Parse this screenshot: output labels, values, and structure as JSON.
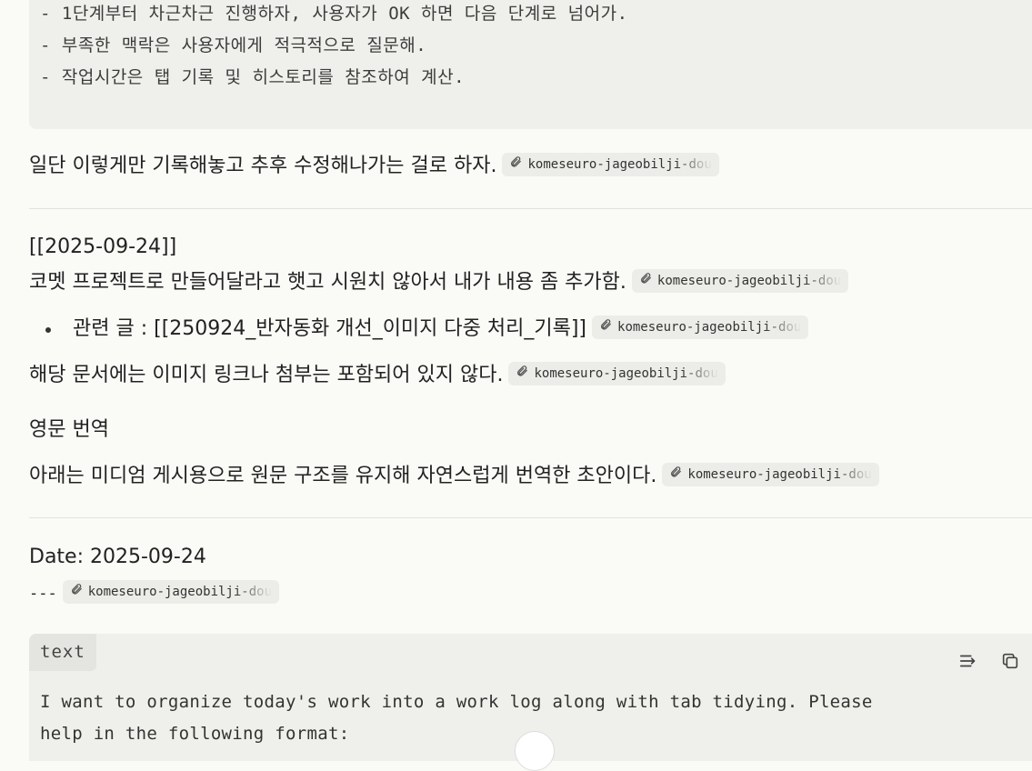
{
  "top_code": {
    "lines": [
      "- 1단계부터 차근차근 진행하자, 사용자가 OK 하면 다음 단계로 넘어가.",
      "- 부족한 맥락은 사용자에게 적극적으로 질문해.",
      "- 작업시간은 탭 기록 및 히스토리를 참조하여 계산."
    ]
  },
  "chip_label": "komeseuro-jageobilji-dou",
  "section1": {
    "note": "일단 이렇게만 기록해놓고 추후 수정해나가는 걸로 하자."
  },
  "section2": {
    "date_link": "[[2025-09-24]]",
    "line1": "코멧 프로젝트로 만들어달라고 햇고 시원치 않아서 내가 내용 좀 추가함.",
    "bullet": "관련 글 : [[250924_반자동화 개선_이미지 다중 처리_기록]]",
    "line2": "해당 문서에는 이미지 링크나 첨부는 포함되어 있지 않다.",
    "heading": "영문 번역",
    "line3": "아래는 미디엄 게시용으로 원문 구조를 유지해 자연스럽게 번역한 초안이다."
  },
  "section3": {
    "date_line": "Date: 2025-09-24",
    "separator": "---"
  },
  "code_block": {
    "lang": "text",
    "lines": [
      "I want to organize today's work into a work log along with tab tidying. Please",
      "help in the following format:"
    ]
  }
}
